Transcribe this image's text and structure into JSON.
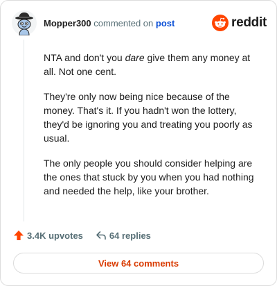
{
  "comment": {
    "username": "Mopper300",
    "action_text": "commented on",
    "post_link": "post",
    "avatar_icon": "snoo-hat-avatar-icon",
    "paragraphs": [
      {
        "before": "NTA and don't you ",
        "emphasis": "dare",
        "after": " give them any money at all. Not one cent."
      },
      {
        "text": "They're only now being nice because of the money. That's it. If you hadn't won the lottery, they'd be ignoring you and treating you poorly as usual."
      },
      {
        "text": "The only people you should consider helping are the ones that stuck by you when you had nothing and needed the help, like your brother."
      }
    ]
  },
  "brand": {
    "wordmark": "reddit",
    "icon": "reddit-logo-icon",
    "color": "#ff4500"
  },
  "actions": {
    "upvotes_label": "3.4K upvotes",
    "upvote_icon": "upvote-arrow-icon",
    "upvote_color": "#ff4500",
    "replies_label": "64 replies",
    "reply_icon": "reply-arrow-icon"
  },
  "footer": {
    "view_comments_label": "View 64 comments",
    "accent_color": "#d93a00"
  }
}
